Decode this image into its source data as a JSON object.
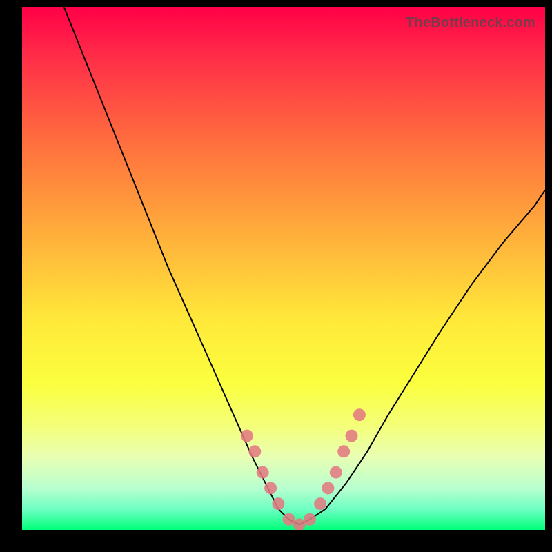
{
  "watermark": "TheBottleneck.com",
  "chart_data": {
    "type": "line",
    "title": "",
    "xlabel": "",
    "ylabel": "",
    "xlim": [
      0,
      100
    ],
    "ylim": [
      0,
      100
    ],
    "curve": {
      "x": [
        8,
        12,
        16,
        20,
        24,
        28,
        32,
        36,
        40,
        44,
        47,
        49,
        51,
        53,
        55,
        58,
        62,
        66,
        70,
        75,
        80,
        86,
        92,
        98,
        100
      ],
      "y": [
        100,
        90,
        80,
        70,
        60,
        50,
        41,
        32,
        23,
        14,
        8,
        4,
        2,
        1,
        2,
        4,
        9,
        15,
        22,
        30,
        38,
        47,
        55,
        62,
        65
      ]
    },
    "highlight_points": {
      "x": [
        43,
        44.5,
        46,
        47.5,
        49,
        51,
        53,
        55,
        57,
        58.5,
        60,
        61.5,
        63,
        64.5
      ],
      "y": [
        18,
        15,
        11,
        8,
        5,
        2,
        1,
        2,
        5,
        8,
        11,
        15,
        18,
        22
      ]
    },
    "colors": {
      "curve": "#000000",
      "points": "#e37a82",
      "gradient_top": "#ff0047",
      "gradient_bottom": "#00ff7a"
    }
  }
}
